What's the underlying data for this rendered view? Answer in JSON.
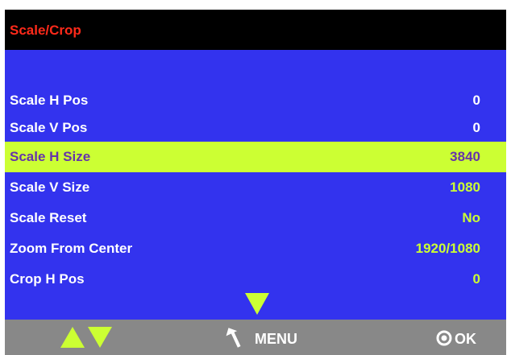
{
  "header": {
    "title": "Scale/Crop"
  },
  "menu": {
    "rows": [
      {
        "label": "Scale H Pos",
        "value": "0"
      },
      {
        "label": "Scale V Pos",
        "value": "0"
      },
      {
        "label": "Scale H Size",
        "value": "3840"
      },
      {
        "label": "Scale V Size",
        "value": "1080"
      },
      {
        "label": "Scale Reset",
        "value": "No"
      },
      {
        "label": "Zoom From Center",
        "value": "1920/1080"
      },
      {
        "label": "Crop H Pos",
        "value": "0"
      }
    ],
    "selected_index": 2
  },
  "footer": {
    "menu_label": "MENU",
    "ok_label": "OK",
    "icons": [
      "up-arrow-icon",
      "down-arrow-icon",
      "back-arrow-icon",
      "ok-button-icon"
    ]
  },
  "colors": {
    "background": "#3333ee",
    "title_bar": "#000000",
    "title_text": "#ff2a1a",
    "highlight": "#ccff33",
    "highlight_text": "#6633aa",
    "footer": "#888888"
  }
}
